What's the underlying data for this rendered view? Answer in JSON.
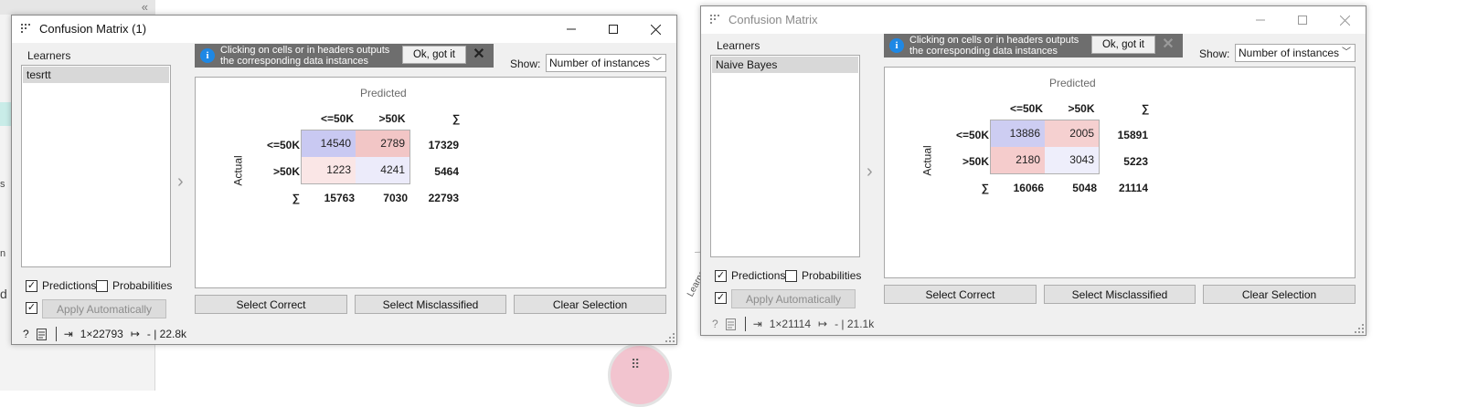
{
  "background": {
    "collapse_glyph": "«",
    "left_fragments": [
      "s",
      "n",
      "d"
    ],
    "node_label": "Learner"
  },
  "windows": [
    {
      "title": "Confusion Matrix (1)",
      "learners_label": "Learners",
      "learners": [
        "tesrtt"
      ],
      "predictions_label": "Predictions",
      "predictions_checked": true,
      "probabilities_label": "Probabilities",
      "probabilities_checked": false,
      "apply_checked": true,
      "apply_label": "Apply Automatically",
      "banner_text": "Clicking on cells or in headers outputs the corresponding data instances",
      "ok_label": "Ok, got it",
      "show_label": "Show:",
      "show_value": "Number of instances",
      "predicted_label": "Predicted",
      "actual_label": "Actual",
      "col_headers": [
        "<=50K",
        ">50K",
        "∑"
      ],
      "row_headers": [
        "<=50K",
        ">50K",
        "∑"
      ],
      "matrix": [
        [
          14540,
          2789
        ],
        [
          1223,
          4241
        ]
      ],
      "row_sums": [
        "17329",
        "5464"
      ],
      "col_sums": [
        "15763",
        "7030",
        "22793"
      ],
      "cells_text": [
        [
          "14540",
          "2789"
        ],
        [
          "1223",
          "4241"
        ]
      ],
      "cell_colors": [
        [
          "#c9c9f2",
          "#f2c6c6"
        ],
        [
          "#fae6e6",
          "#ecebfa"
        ]
      ],
      "select_correct": "Select Correct",
      "select_misclassified": "Select Misclassified",
      "clear_selection": "Clear Selection",
      "status_input": "1×22793",
      "status_output": "- | 22.8k"
    },
    {
      "title": "Confusion Matrix",
      "learners_label": "Learners",
      "learners": [
        "Naive Bayes"
      ],
      "predictions_label": "Predictions",
      "predictions_checked": true,
      "probabilities_label": "Probabilities",
      "probabilities_checked": false,
      "apply_checked": true,
      "apply_label": "Apply Automatically",
      "banner_text": "Clicking on cells or in headers outputs the corresponding data instances",
      "ok_label": "Ok, got it",
      "show_label": "Show:",
      "show_value": "Number of instances",
      "predicted_label": "Predicted",
      "actual_label": "Actual",
      "col_headers": [
        "<=50K",
        ">50K",
        "∑"
      ],
      "row_headers": [
        "<=50K",
        ">50K",
        "∑"
      ],
      "matrix": [
        [
          13886,
          2005
        ],
        [
          2180,
          3043
        ]
      ],
      "row_sums": [
        "15891",
        "5223"
      ],
      "col_sums": [
        "16066",
        "5048",
        "21114"
      ],
      "cells_text": [
        [
          "13886",
          "2005"
        ],
        [
          "2180",
          "3043"
        ]
      ],
      "cell_colors": [
        [
          "#cdcdf2",
          "#f5d0d0"
        ],
        [
          "#f5cccc",
          "#eeeefb"
        ]
      ],
      "select_correct": "Select Correct",
      "select_misclassified": "Select Misclassified",
      "clear_selection": "Clear Selection",
      "status_input": "1×21114",
      "status_output": "- | 21.1k"
    }
  ]
}
